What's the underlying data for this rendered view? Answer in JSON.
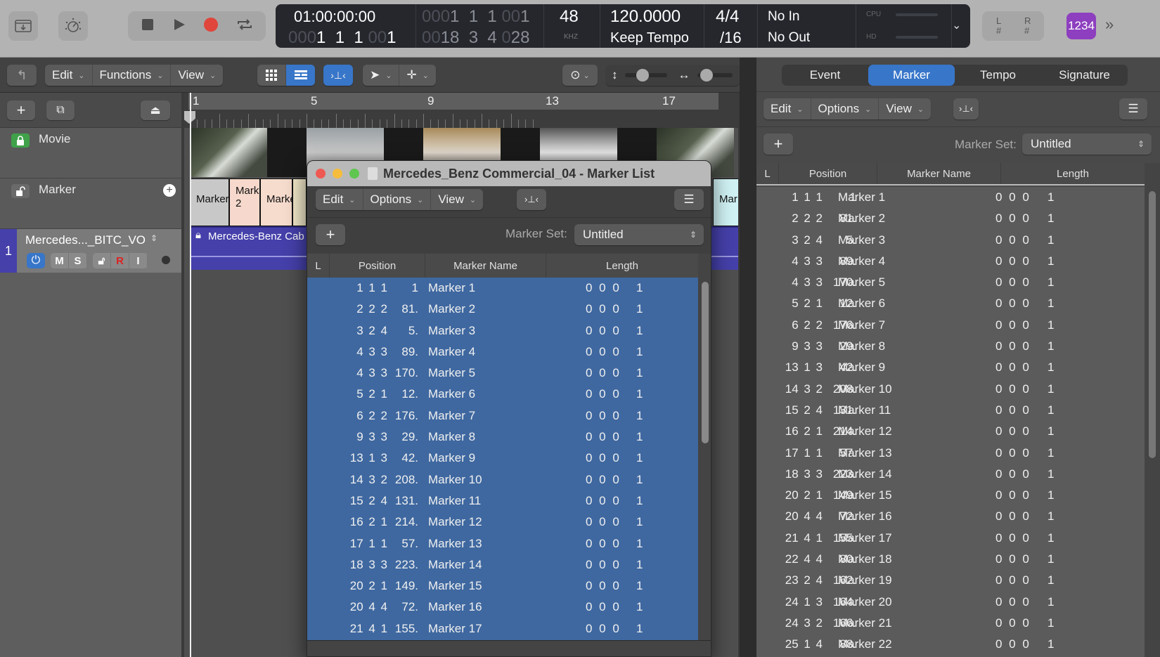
{
  "control_bar": {
    "icons": [
      "library-download-icon",
      "tuner-icon"
    ],
    "transport": [
      "stop-icon",
      "play-icon",
      "record-icon",
      "cycle-icon"
    ],
    "lcd": {
      "smpte": "01:00:00:00",
      "bars_dim": "000",
      "bars_main": "1  1  1",
      "bars_tick_dim": "00",
      "bars_tick": "1",
      "left_locator_dim": "000",
      "left_locator": "1  1  1",
      "left_locator_tick_dim": "00",
      "left_locator_tick": "1",
      "right_locator_dim": "00",
      "right_locator": "18  3  4",
      "right_locator_tick_dim": "0",
      "right_locator_tick": "28",
      "sample_rate": "48",
      "sample_rate_unit": "KHZ",
      "tempo": "120.0000",
      "tempo_mode": "Keep Tempo",
      "signature": "4/4",
      "division": "/16",
      "midi_in": "No In",
      "midi_out": "No Out",
      "cpu_label": "CPU",
      "hd_label": "HD"
    },
    "lr_left": "L",
    "lr_right": "R",
    "lr_hash": "#",
    "count_in": "1234"
  },
  "toolbar": {
    "edit": "Edit",
    "functions": "Functions",
    "view": "View"
  },
  "tracks": {
    "movie": "Movie",
    "marker": "Marker",
    "track_number": "1",
    "track_name": "Mercedes..._BITC_VO",
    "buttons": [
      "M",
      "S",
      "R",
      "I"
    ]
  },
  "ruler": {
    "bars": [
      "1",
      "5",
      "9",
      "13",
      "17"
    ]
  },
  "arrange": {
    "markers": [
      "Marker",
      "Mark\n2",
      "Marke",
      "Mar"
    ],
    "region_name": "Mercedes-Benz Cab"
  },
  "right_panel": {
    "tabs": [
      "Event",
      "Marker",
      "Tempo",
      "Signature"
    ],
    "active_tab": "Marker",
    "edit": "Edit",
    "options": "Options",
    "view": "View",
    "marker_set_label": "Marker Set:",
    "marker_set_value": "Untitled",
    "columns": [
      "L",
      "Position",
      "Marker Name",
      "Length"
    ]
  },
  "marker_list_window": {
    "title": "Mercedes_Benz Commercial_04 - Marker List",
    "edit": "Edit",
    "options": "Options",
    "view": "View",
    "marker_set_label": "Marker Set:",
    "marker_set_value": "Untitled",
    "columns": [
      "L",
      "Position",
      "Marker Name",
      "Length"
    ]
  },
  "markers": [
    {
      "pos": "1 1 1",
      "tick": "1",
      "name": "Marker 1",
      "len": "0 0 0",
      "len_tick": "1"
    },
    {
      "pos": "2 2 2",
      "tick": "81.",
      "name": "Marker 2",
      "len": "0 0 0",
      "len_tick": "1"
    },
    {
      "pos": "3 2 4",
      "tick": "5.",
      "name": "Marker 3",
      "len": "0 0 0",
      "len_tick": "1"
    },
    {
      "pos": "4 3 3",
      "tick": "89.",
      "name": "Marker 4",
      "len": "0 0 0",
      "len_tick": "1"
    },
    {
      "pos": "4 3 3",
      "tick": "170.",
      "name": "Marker 5",
      "len": "0 0 0",
      "len_tick": "1"
    },
    {
      "pos": "5 2 1",
      "tick": "12.",
      "name": "Marker 6",
      "len": "0 0 0",
      "len_tick": "1"
    },
    {
      "pos": "6 2 2",
      "tick": "176.",
      "name": "Marker 7",
      "len": "0 0 0",
      "len_tick": "1"
    },
    {
      "pos": "9 3 3",
      "tick": "29.",
      "name": "Marker 8",
      "len": "0 0 0",
      "len_tick": "1"
    },
    {
      "pos": "13 1 3",
      "tick": "42.",
      "name": "Marker 9",
      "len": "0 0 0",
      "len_tick": "1"
    },
    {
      "pos": "14 3 2",
      "tick": "208.",
      "name": "Marker 10",
      "len": "0 0 0",
      "len_tick": "1"
    },
    {
      "pos": "15 2 4",
      "tick": "131.",
      "name": "Marker 11",
      "len": "0 0 0",
      "len_tick": "1"
    },
    {
      "pos": "16 2 1",
      "tick": "214.",
      "name": "Marker 12",
      "len": "0 0 0",
      "len_tick": "1"
    },
    {
      "pos": "17 1 1",
      "tick": "57.",
      "name": "Marker 13",
      "len": "0 0 0",
      "len_tick": "1"
    },
    {
      "pos": "18 3 3",
      "tick": "223.",
      "name": "Marker 14",
      "len": "0 0 0",
      "len_tick": "1"
    },
    {
      "pos": "20 2 1",
      "tick": "149.",
      "name": "Marker 15",
      "len": "0 0 0",
      "len_tick": "1"
    },
    {
      "pos": "20 4 4",
      "tick": "72.",
      "name": "Marker 16",
      "len": "0 0 0",
      "len_tick": "1"
    },
    {
      "pos": "21 4 1",
      "tick": "155.",
      "name": "Marker 17",
      "len": "0 0 0",
      "len_tick": "1"
    },
    {
      "pos": "22 4 4",
      "tick": "80.",
      "name": "Marker 18",
      "len": "0 0 0",
      "len_tick": "1"
    },
    {
      "pos": "23 2 4",
      "tick": "162.",
      "name": "Marker 19",
      "len": "0 0 0",
      "len_tick": "1"
    },
    {
      "pos": "24 1 3",
      "tick": "164.",
      "name": "Marker 20",
      "len": "0 0 0",
      "len_tick": "1"
    },
    {
      "pos": "24 3 2",
      "tick": "166.",
      "name": "Marker 21",
      "len": "0 0 0",
      "len_tick": "1"
    },
    {
      "pos": "25 1 4",
      "tick": "88.",
      "name": "Marker 22",
      "len": "0 0 0",
      "len_tick": "1"
    }
  ],
  "colors": {
    "selection": "#3f68a0",
    "accent": "#3876c9",
    "track_region": "#4540aa",
    "count_in": "#8d3fbf",
    "record": "#e0463b"
  }
}
